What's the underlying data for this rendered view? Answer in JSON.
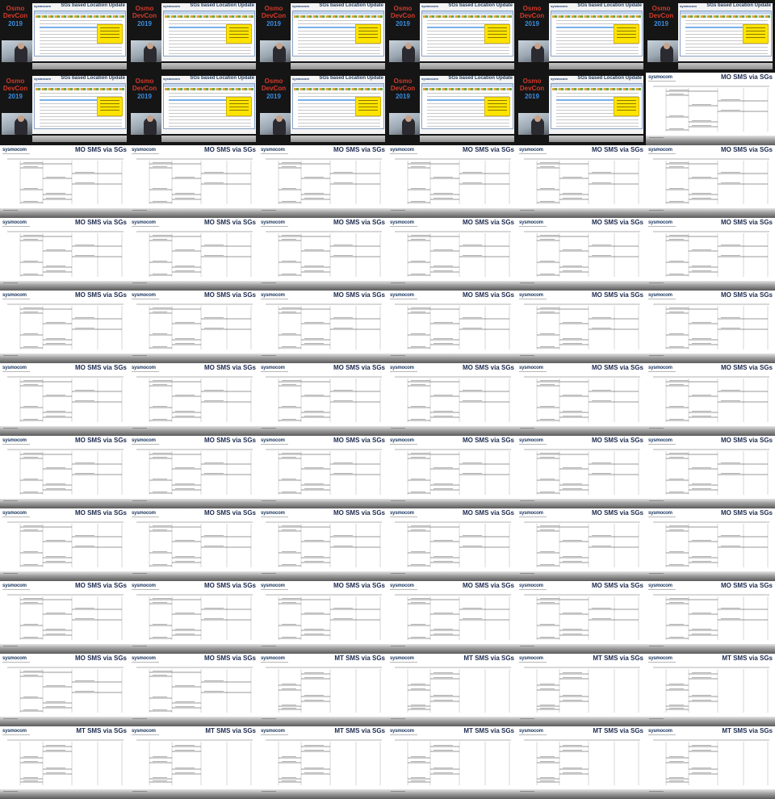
{
  "grid": {
    "columns": 6,
    "rows": 11
  },
  "video_logo": [
    "Osmo",
    "DevCon",
    "2019"
  ],
  "slide_brand": "sysmocom",
  "titles": {
    "lu": "SGs based Location Update",
    "mo": "MO SMS via SGs",
    "mt": "MT SMS via SGs"
  },
  "frames": [
    "lu",
    "lu",
    "lu",
    "lu",
    "lu",
    "lu",
    "lu",
    "lu",
    "lu",
    "lu",
    "lu",
    "mo",
    "mo",
    "mo",
    "mo",
    "mo",
    "mo",
    "mo",
    "mo",
    "mo",
    "mo",
    "mo",
    "mo",
    "mo",
    "mo",
    "mo",
    "mo",
    "mo",
    "mo",
    "mo",
    "mo",
    "mo",
    "mo",
    "mo",
    "mo",
    "mo",
    "mo",
    "mo",
    "mo",
    "mo",
    "mo",
    "mo",
    "mo",
    "mo",
    "mo",
    "mo",
    "mo",
    "mo",
    "mo",
    "mo",
    "mo",
    "mo",
    "mo",
    "mo",
    "mo",
    "mo",
    "mt",
    "mt",
    "mt",
    "mt",
    "mt",
    "mt",
    "mt",
    "mt",
    "mt",
    "mt"
  ],
  "video_frames": [
    true,
    true,
    true,
    true,
    true,
    true,
    true,
    true,
    true,
    true,
    true,
    false
  ],
  "colors": {
    "logo_red": "#d23a2a",
    "logo_blue": "#3b8de0",
    "callout": "#ffe400",
    "brand_navy": "#1d2b4f"
  }
}
